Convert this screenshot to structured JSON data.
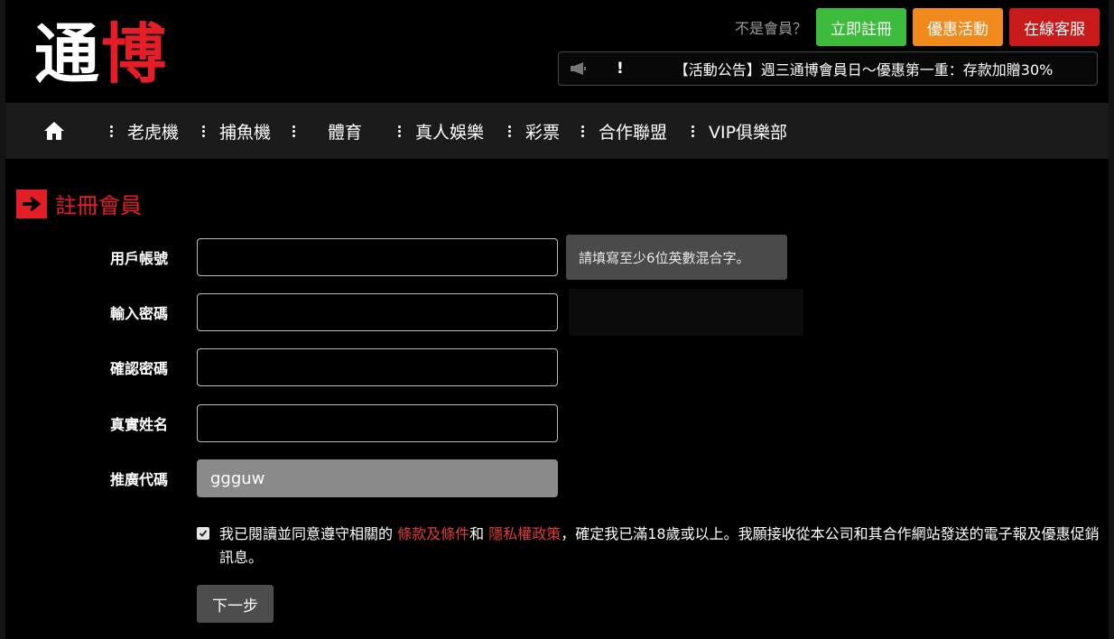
{
  "brand": {
    "logo_part1": "通",
    "logo_part2": "博"
  },
  "header": {
    "not_member": "不是會員？",
    "register_label": "立即註冊",
    "promo_label": "優惠活動",
    "support_label": "在線客服",
    "colors": {
      "register": "#3dbb3d",
      "promo": "#f18a1c",
      "support": "#c81a1a"
    }
  },
  "announcement": {
    "icon": "megaphone-icon",
    "marker": "!",
    "text": "【活動公告】週三通博會員日～優惠第一重：存款加贈30%"
  },
  "nav": {
    "home_icon": "home-icon",
    "items": [
      "老虎機",
      "捕魚機",
      "體育",
      "真人娛樂",
      "彩票",
      "合作聯盟",
      "VIP俱樂部"
    ]
  },
  "page": {
    "title": "註冊會員",
    "accent_color": "#e41e26"
  },
  "form": {
    "username_label": "用戶帳號",
    "username_value": "",
    "password_label": "輸入密碼",
    "password_value": "",
    "confirm_label": "確認密碼",
    "confirm_value": "",
    "realname_label": "真實姓名",
    "realname_value": "",
    "promo_code_label": "推廣代碼",
    "promo_code_value": "ggguw",
    "tooltip": "請填寫至少6位英數混合字。",
    "agree_checked": true,
    "agree_text_1": "我已閱讀並同意遵守相關的 ",
    "terms_link": "條款及條件",
    "agree_text_2": "和 ",
    "privacy_link": "隱私權政策",
    "agree_text_3": "，確定我已滿18歲或以上。我願接收從本公司和其合作網站發送的電子報及優惠促銷訊息。",
    "next_label": "下一步"
  }
}
